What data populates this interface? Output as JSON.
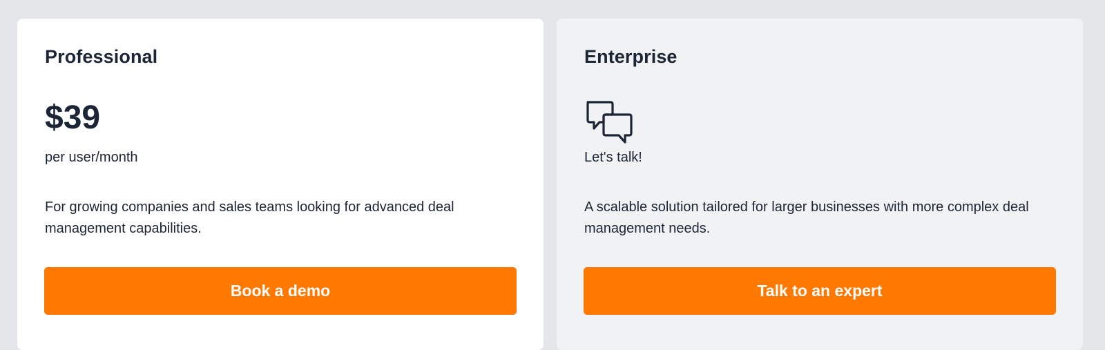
{
  "plans": {
    "professional": {
      "title": "Professional",
      "price": "$39",
      "price_note": "per user/month",
      "description": "For growing companies and sales teams looking for advanced deal management capabilities.",
      "cta_label": "Book a demo"
    },
    "enterprise": {
      "title": "Enterprise",
      "icon": "chat-bubbles-icon",
      "price_note": "Let's talk!",
      "description": "A scalable solution tailored for larger businesses with more complex deal management needs.",
      "cta_label": "Talk to an expert"
    }
  },
  "colors": {
    "page_background": "#e4e6ea",
    "professional_card": "#ffffff",
    "enterprise_card": "#f0f2f4",
    "accent": "#ff7900",
    "text": "#1c2535"
  }
}
